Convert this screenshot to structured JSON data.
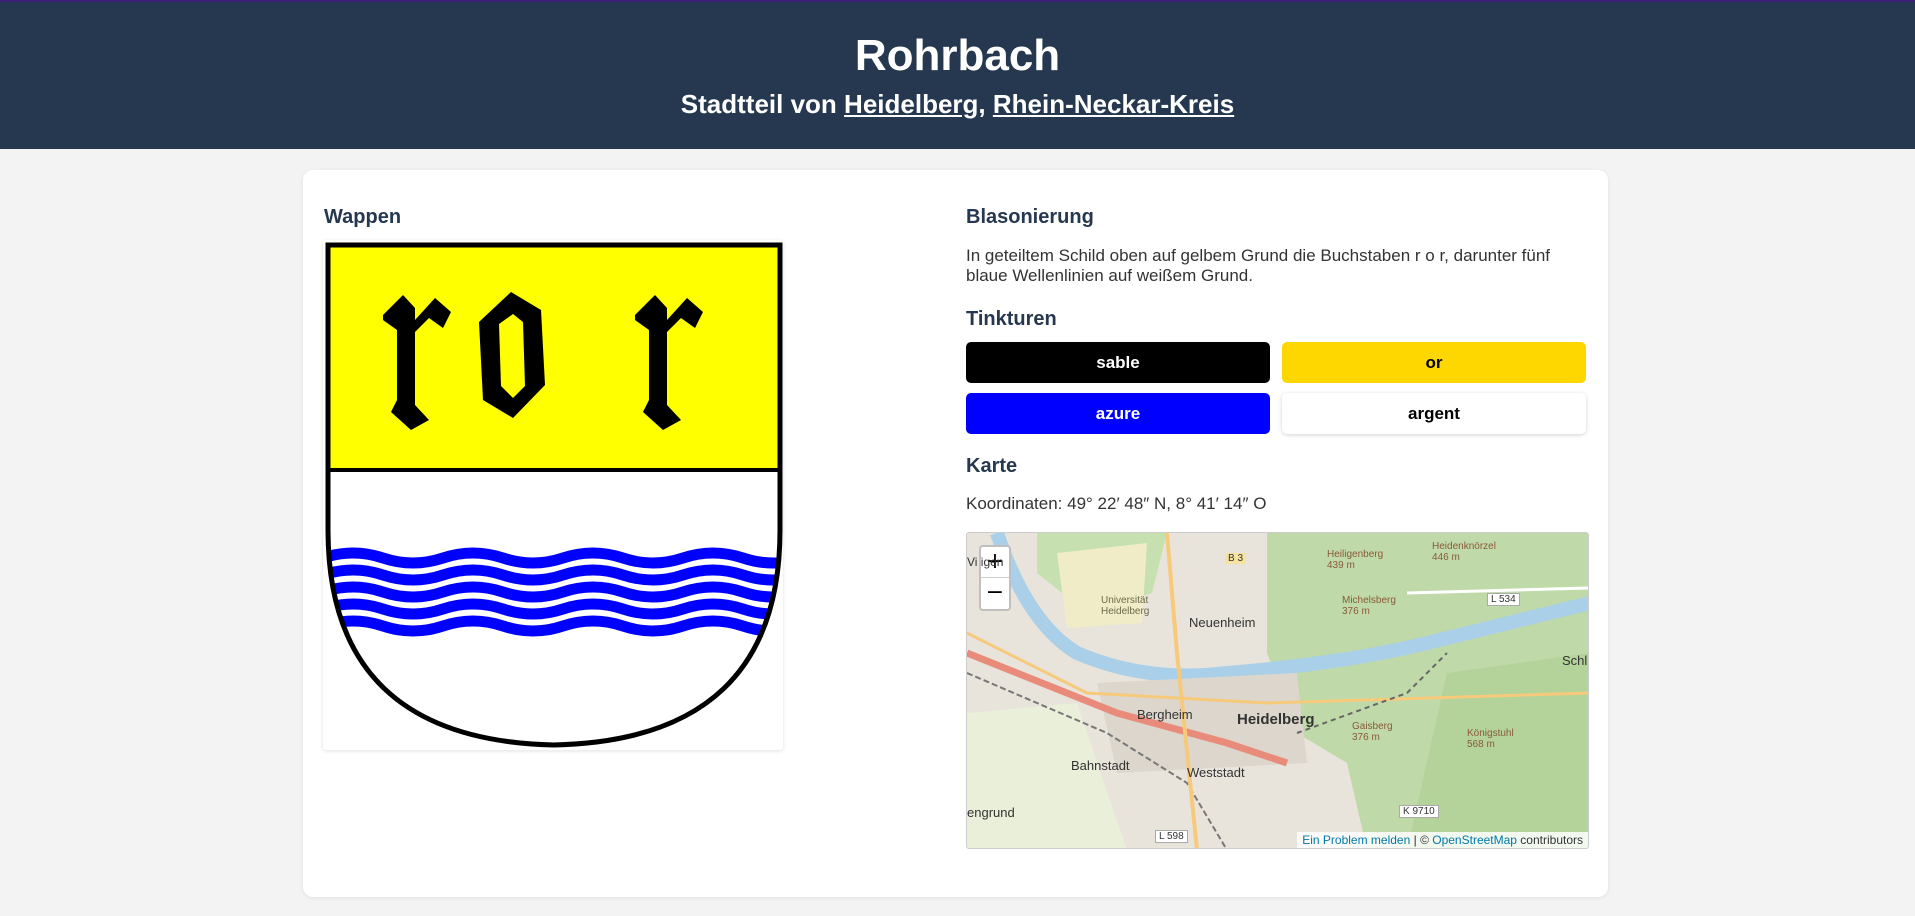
{
  "header": {
    "title": "Rohrbach",
    "subtitle_prefix": "Stadtteil von ",
    "city_link": "Heidelberg",
    "separator": ", ",
    "district_link": "Rhein-Neckar-Kreis"
  },
  "crest": {
    "heading": "Wappen",
    "letters": "ror",
    "colors": {
      "top": "#ffff00",
      "bottom": "#ffffff",
      "waves": "#0000ff",
      "outline": "#000000"
    }
  },
  "blazon": {
    "heading": "Blasonierung",
    "text": "In geteiltem Schild oben auf gelbem Grund die Buchstaben r o r, darunter fünf blaue Wellenlinien auf weißem Grund."
  },
  "tinctures": {
    "heading": "Tinkturen",
    "items": [
      {
        "label": "sable",
        "bg": "#000000",
        "fg": "#ffffff"
      },
      {
        "label": "or",
        "bg": "#ffd700",
        "fg": "#000000"
      },
      {
        "label": "azure",
        "bg": "#0000ff",
        "fg": "#ffffff"
      },
      {
        "label": "argent",
        "bg": "#ffffff",
        "fg": "#000000"
      }
    ]
  },
  "map": {
    "heading": "Karte",
    "coordinates": "Koordinaten: 49° 22′ 48″ N, 8° 41′ 14″ O",
    "zoom_in": "+",
    "zoom_out": "−",
    "attribution_report": "Ein Problem melden",
    "attribution_sep": " | © ",
    "attribution_osm": "OpenStreetMap",
    "attribution_suffix": " contributors",
    "labels": {
      "heidelberg": "Heidelberg",
      "neuenheim": "Neuenheim",
      "bergheim": "Bergheim",
      "bahnstadt": "Bahnstadt",
      "weststadt": "Weststadt",
      "uni": "Universität Heidelberg",
      "heiligenberg": "Heiligenberg 439 m",
      "heidenknorzel": "Heidenknörzel 446 m",
      "michelsberg": "Michelsberg 376 m",
      "gaisberg": "Gaisberg 376 m",
      "koenigstuhl": "Königstuhl 568 m",
      "b3": "B 3",
      "l534": "L 534",
      "k9710": "K 9710",
      "l598": "L 598",
      "schlie": "Schlie",
      "engrund": "engrund",
      "vieigen": "Vi   igen"
    }
  }
}
